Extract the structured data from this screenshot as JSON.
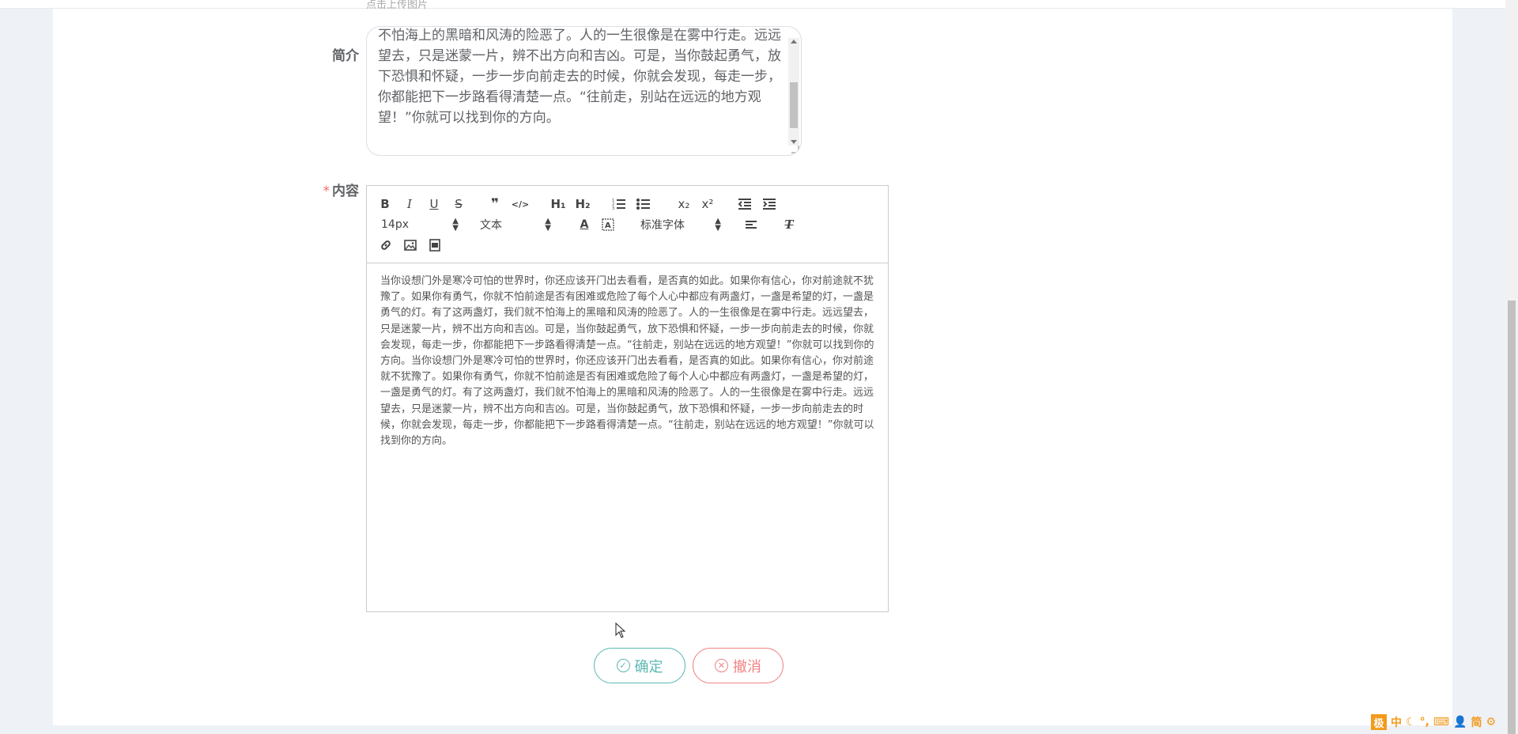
{
  "upload_hint": "点击上传图片",
  "intro": {
    "label": "简介",
    "text": "不怕海上的黑暗和风涛的险恶了。人的一生很像是在雾中行走。远远望去，只是迷蒙一片，辨不出方向和吉凶。可是，当你鼓起勇气，放下恐惧和怀疑，一步一步向前走去的时候，你就会发现，每走一步，你都能把下一步路看得清楚一点。“往前走，别站在远远的地方观望！”你就可以找到你的方向。"
  },
  "content": {
    "required_mark": "*",
    "label": "内容",
    "toolbar": {
      "bold": "B",
      "italic": "I",
      "underline": "U",
      "strike": "S",
      "blockquote": "❞",
      "code": "</>",
      "h1": "H₁",
      "h2": "H₂",
      "subscript": "x₂",
      "superscript": "x²",
      "font_size": "14px",
      "text_type": "文本",
      "font_family": "标准字体"
    },
    "body": "当你设想门外是寒冷可怕的世界时，你还应该开门出去看看，是否真的如此。如果你有信心，你对前途就不犹豫了。如果你有勇气，你就不怕前途是否有困难或危险了每个人心中都应有两盏灯，一盏是希望的灯，一盏是勇气的灯。有了这两盏灯，我们就不怕海上的黑暗和风涛的险恶了。人的一生很像是在雾中行走。远远望去，只是迷蒙一片，辨不出方向和吉凶。可是，当你鼓起勇气，放下恐惧和怀疑，一步一步向前走去的时候，你就会发现，每走一步，你都能把下一步路看得清楚一点。“往前走，别站在远远的地方观望！”你就可以找到你的方向。当你设想门外是寒冷可怕的世界时，你还应该开门出去看看，是否真的如此。如果你有信心，你对前途就不犹豫了。如果你有勇气，你就不怕前途是否有困难或危险了每个人心中都应有两盏灯，一盏是希望的灯，一盏是勇气的灯。有了这两盏灯，我们就不怕海上的黑暗和风涛的险恶了。人的一生很像是在雾中行走。远远望去，只是迷蒙一片，辨不出方向和吉凶。可是，当你鼓起勇气，放下恐惧和怀疑，一步一步向前走去的时候，你就会发现，每走一步，你都能把下一步路看得清楚一点。“往前走，别站在远远的地方观望！”你就可以找到你的方向。"
  },
  "buttons": {
    "confirm": "确定",
    "cancel": "撤消"
  },
  "ime": {
    "logo": "极",
    "mode": "中",
    "script": "简"
  },
  "colors": {
    "confirm": "#5cb8b2",
    "cancel": "#f08282",
    "required": "#f56c6c",
    "ime": "#f39a1c"
  }
}
